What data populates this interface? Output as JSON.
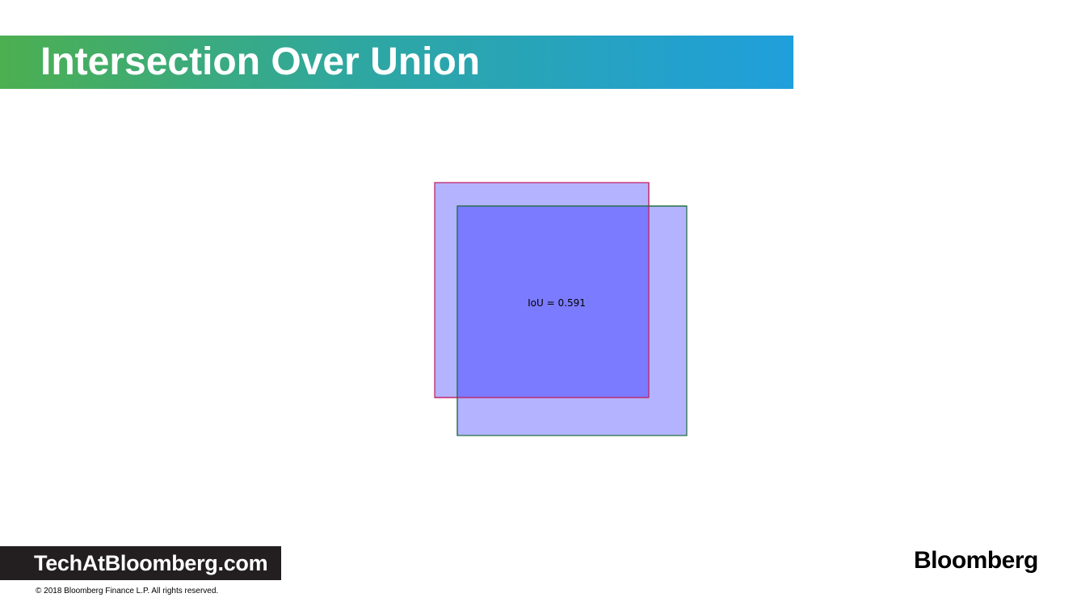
{
  "slide": {
    "title": "Intersection Over Union"
  },
  "diagram": {
    "label": "IoU = 0.591",
    "box_a": {
      "edge_color": "#c2185b",
      "fill_color": "#b3b3ff"
    },
    "box_b": {
      "edge_color": "#1b6b3a",
      "fill_color": "#b3b3ff"
    },
    "intersection_color": "#7b7bff"
  },
  "footer": {
    "site": "TechAtBloomberg.com",
    "copyright": "© 2018 Bloomberg Finance L.P. All rights reserved.",
    "brand": "Bloomberg"
  },
  "colors": {
    "title_gradient_start": "#4caf50",
    "title_gradient_end": "#1f9fdc",
    "badge_background": "#231f20"
  }
}
